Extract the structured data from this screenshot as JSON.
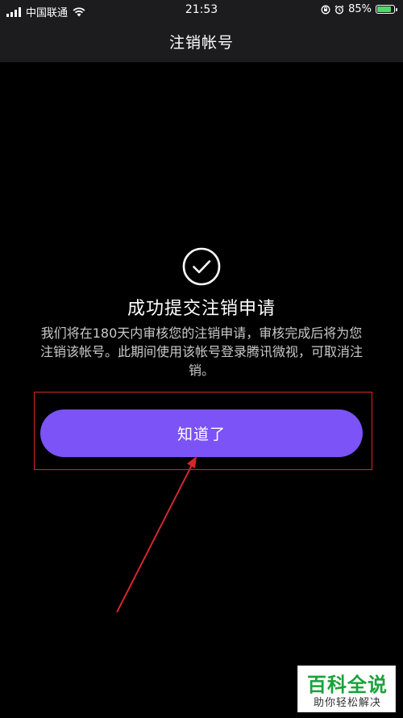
{
  "status_bar": {
    "carrier": "中国联通",
    "time": "21:53",
    "battery_percent_label": "85%",
    "battery_level": 0.85,
    "icons": [
      "signal-icon",
      "wifi-icon",
      "lock-rotation-icon",
      "alarm-icon",
      "battery-icon"
    ]
  },
  "nav": {
    "title": "注销帐号"
  },
  "main": {
    "success_icon": "check-circle-icon",
    "title": "成功提交注销申请",
    "description": "我们将在180天内审核您的注销申请，审核完成后将为您注销该帐号。此期间使用该帐号登录腾讯微视，可取消注销。",
    "confirm_button_label": "知道了"
  },
  "watermark": {
    "title": "百科全说",
    "subtitle": "助你轻松解决"
  },
  "colors": {
    "background": "#000000",
    "bar": "#1c1c1e",
    "button": "#7b53f6",
    "annotation": "#d6262b",
    "watermark_green": "#1aa23a"
  }
}
